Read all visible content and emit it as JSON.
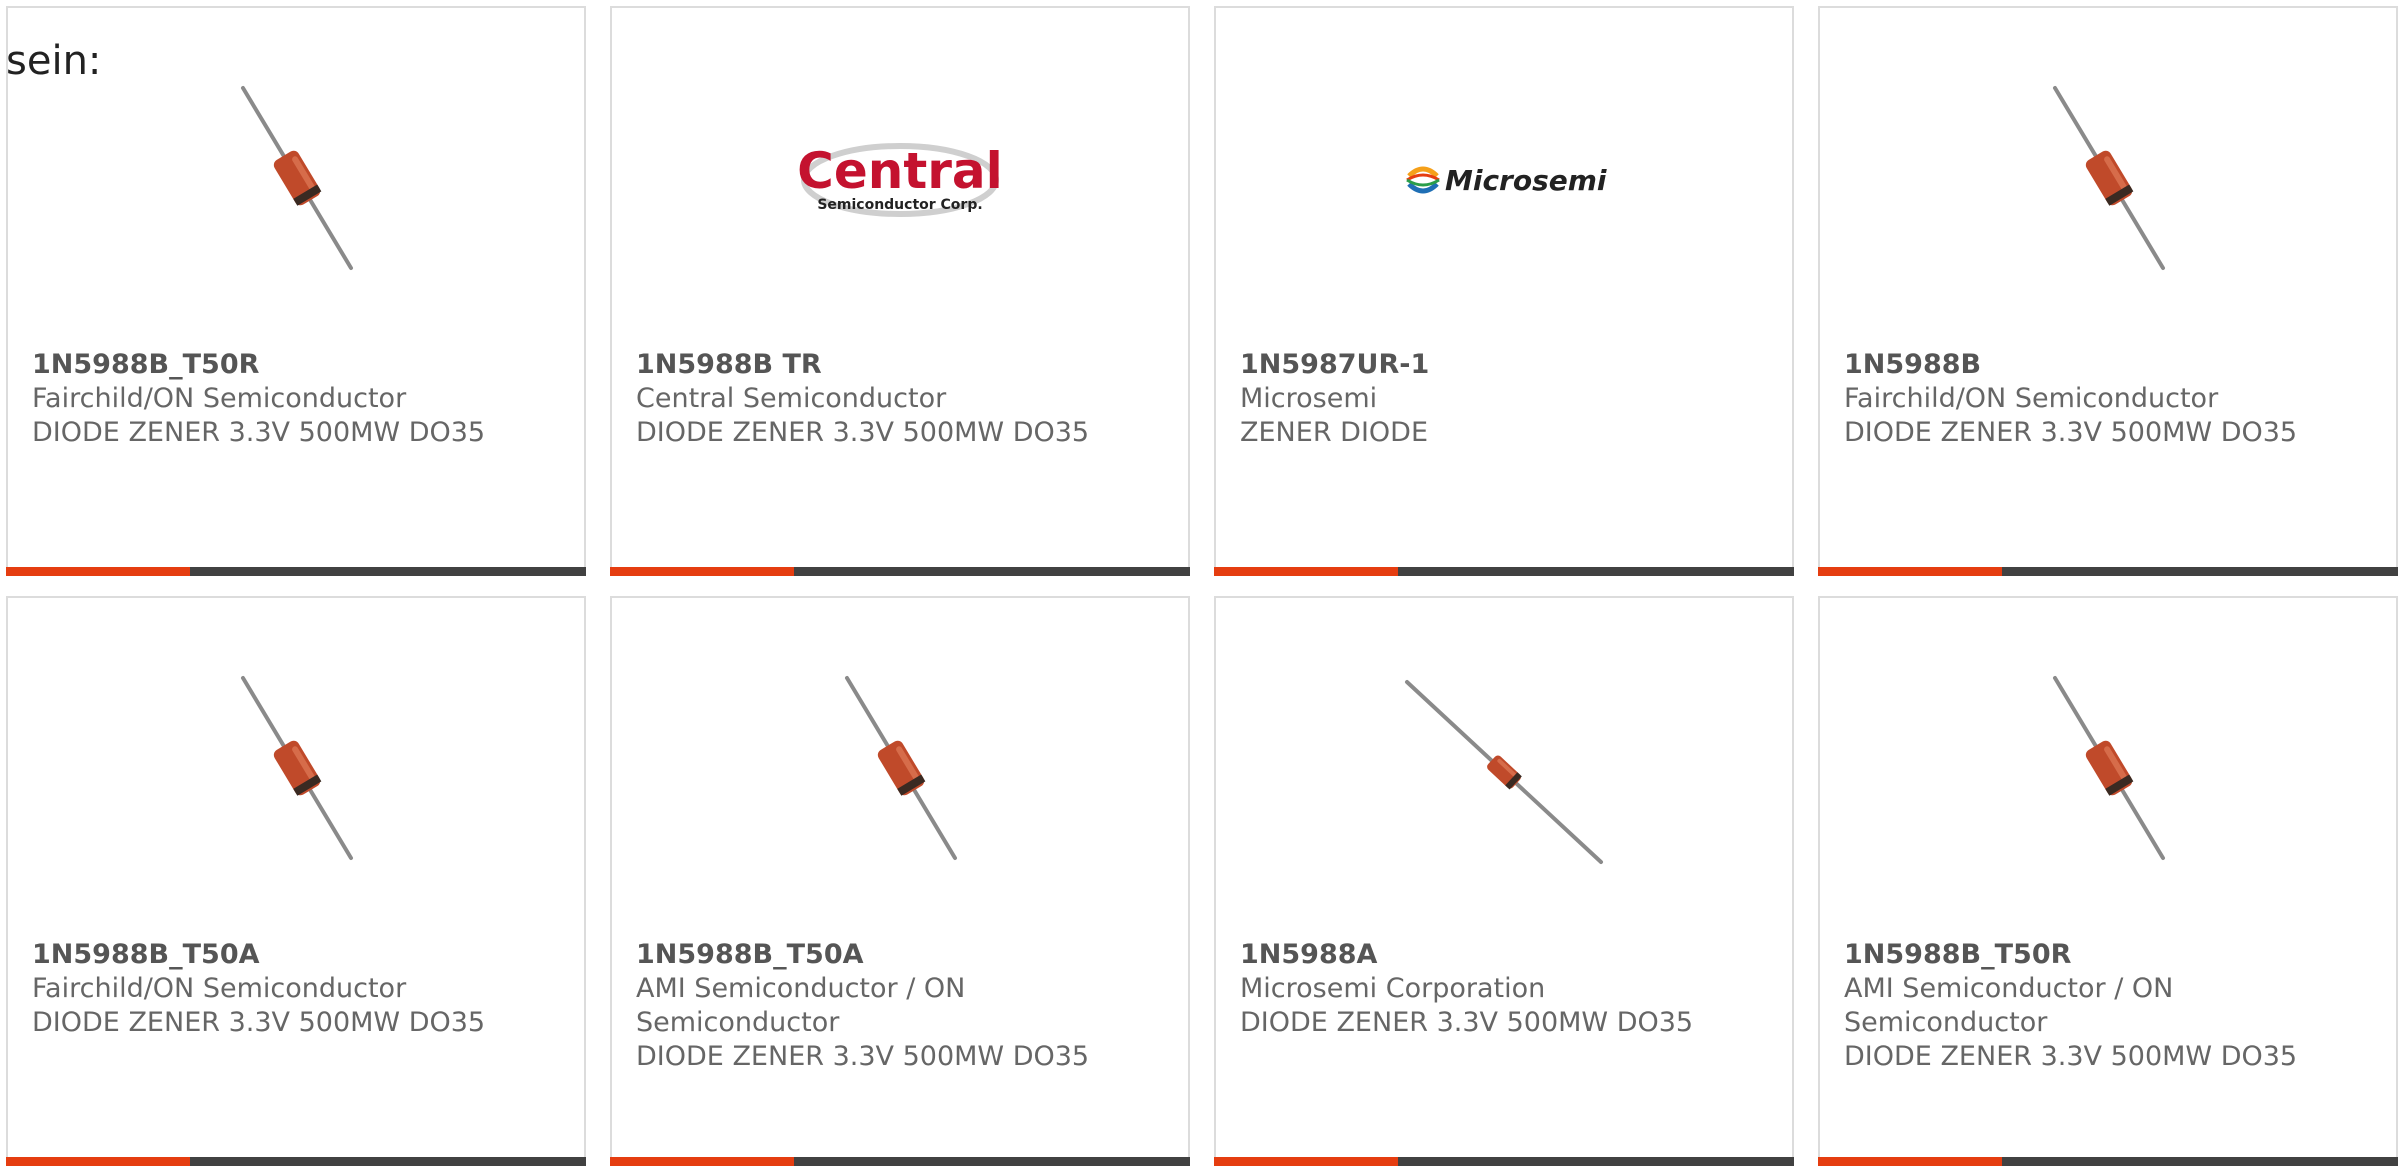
{
  "lead_text": "sein:",
  "cards": [
    {
      "part_number": "1N5988B_T50R",
      "manufacturer": "Fairchild/ON Semiconductor",
      "description": "DIODE ZENER 3.3V 500MW DO35",
      "image": "diode-steep-icon"
    },
    {
      "part_number": "1N5988B TR",
      "manufacturer": "Central Semiconductor",
      "description": "DIODE ZENER 3.3V 500MW DO35",
      "image": "central-logo",
      "logo_text": "Central",
      "logo_subtext": "Semiconductor Corp."
    },
    {
      "part_number": "1N5987UR-1",
      "manufacturer": "Microsemi",
      "description": "ZENER DIODE",
      "image": "microsemi-logo",
      "logo_text": "Microsemi"
    },
    {
      "part_number": "1N5988B",
      "manufacturer": "Fairchild/ON Semiconductor",
      "description": "DIODE ZENER 3.3V 500MW DO35",
      "image": "diode-steep-icon"
    },
    {
      "part_number": "1N5988B_T50A",
      "manufacturer": "Fairchild/ON Semiconductor",
      "description": "DIODE ZENER 3.3V 500MW DO35",
      "image": "diode-steep-icon"
    },
    {
      "part_number": "1N5988B_T50A",
      "manufacturer": "AMI Semiconductor / ON Semiconductor",
      "description": "DIODE ZENER 3.3V 500MW DO35",
      "image": "diode-steep-icon"
    },
    {
      "part_number": "1N5988A",
      "manufacturer": "Microsemi Corporation",
      "description": "DIODE ZENER 3.3V 500MW DO35",
      "image": "diode-shallow-icon"
    },
    {
      "part_number": "1N5988B_T50R",
      "manufacturer": "AMI Semiconductor / ON Semiconductor",
      "description": "DIODE ZENER 3.3V 500MW DO35",
      "image": "diode-steep-icon"
    }
  ],
  "colors": {
    "accent": "#e53d10",
    "bar": "#414141",
    "border": "#dcdcdc",
    "text": "#555555",
    "diode_body": "#c04a2a",
    "central_logo": "#c4122f"
  }
}
